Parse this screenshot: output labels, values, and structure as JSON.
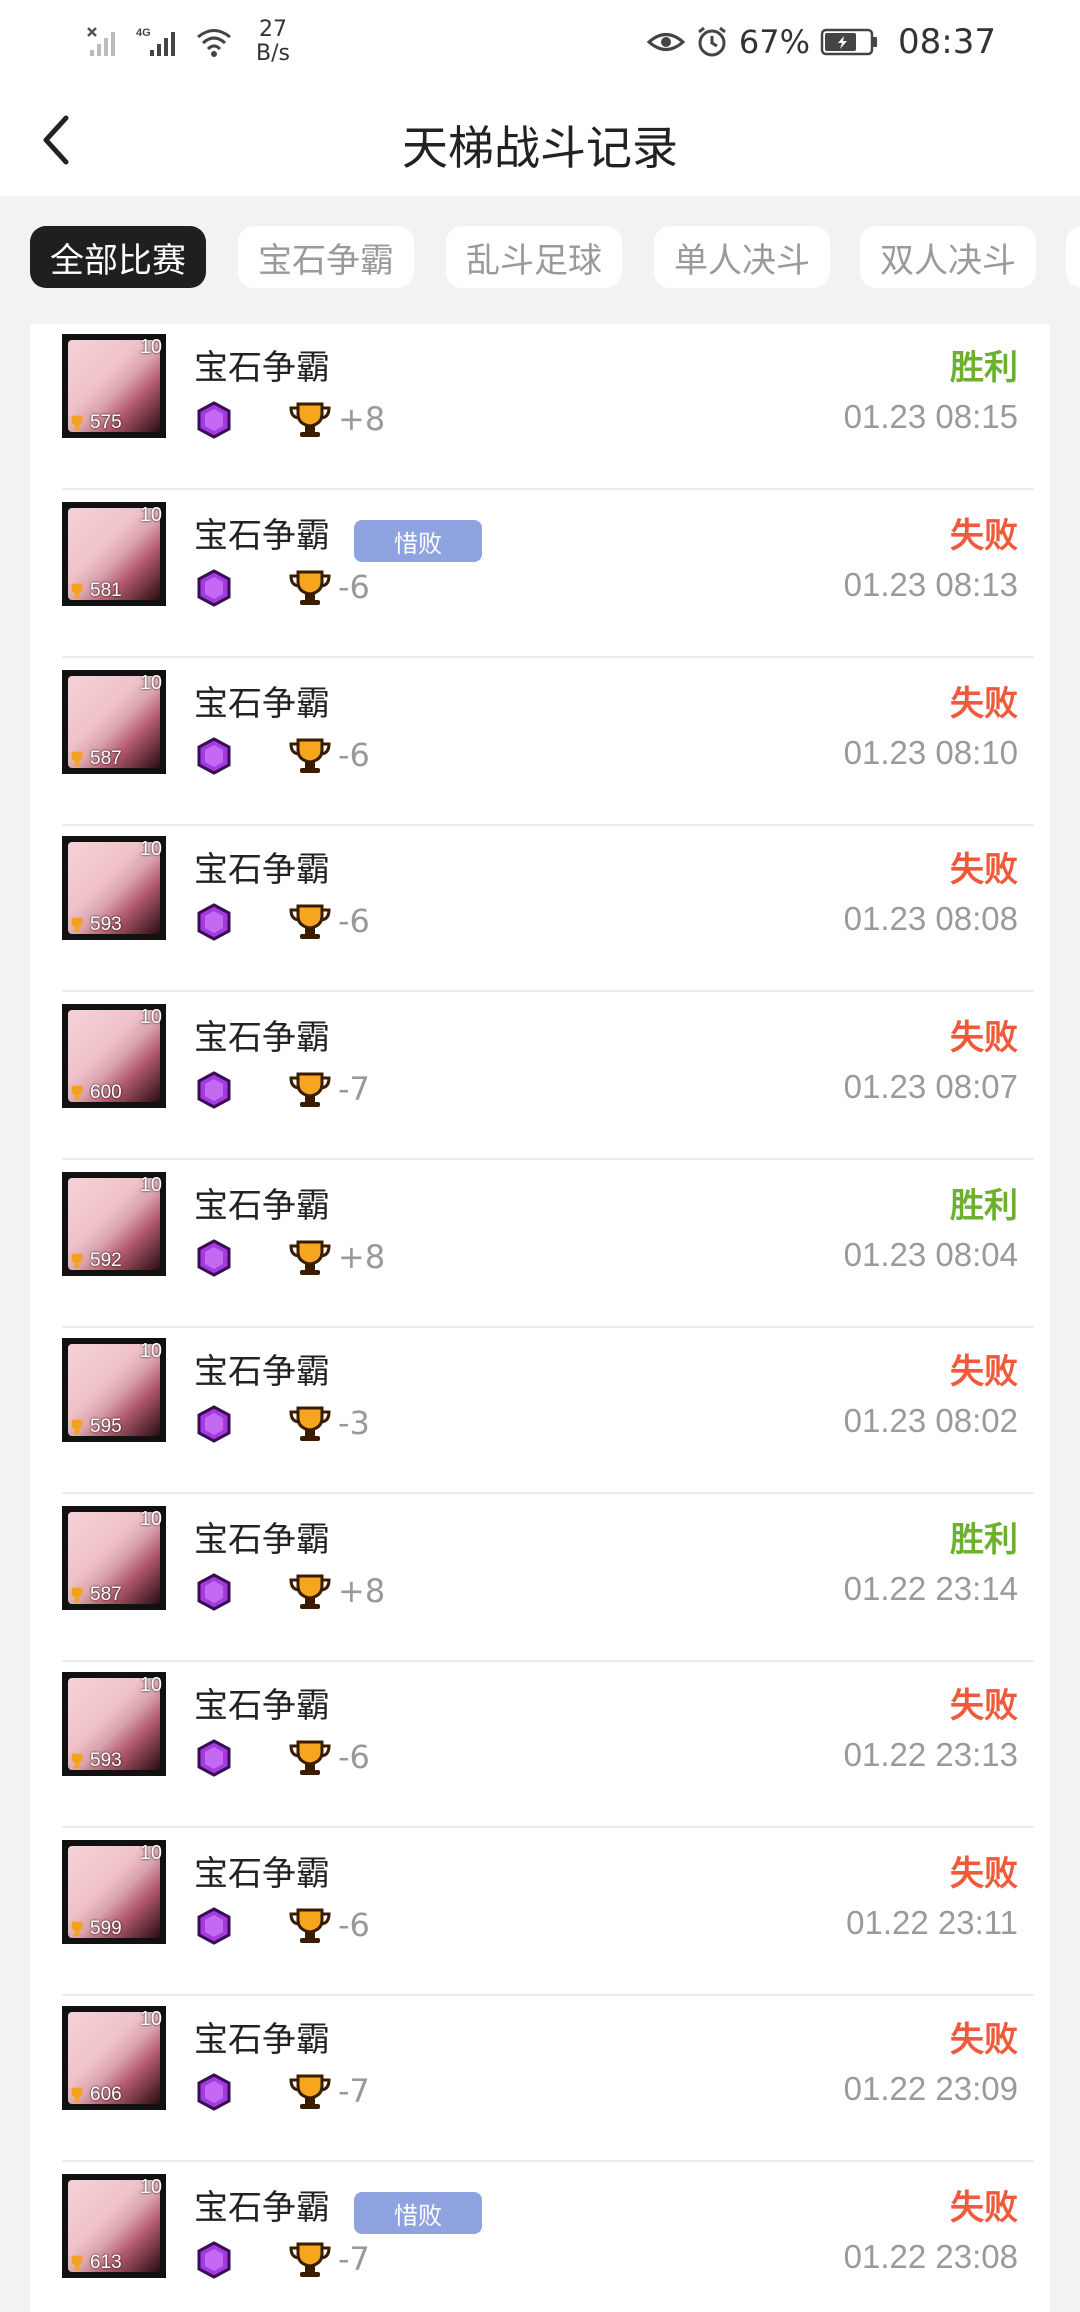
{
  "status_bar": {
    "net_speed_value": "27",
    "net_speed_unit": "B/s",
    "battery_percent": "67%",
    "time": "08:37",
    "icons": [
      "no-signal-icon",
      "4g-signal-icon",
      "wifi-icon",
      "eye-icon",
      "alarm-icon",
      "battery-icon"
    ]
  },
  "header": {
    "title": "天梯战斗记录",
    "back_icon": "chevron-left-icon"
  },
  "tabs": [
    {
      "label": "全部比赛",
      "active": true
    },
    {
      "label": "宝石争霸",
      "active": false
    },
    {
      "label": "乱斗足球",
      "active": false
    },
    {
      "label": "单人决斗",
      "active": false
    },
    {
      "label": "双人决斗",
      "active": false
    }
  ],
  "colors": {
    "win": "#6bb12d",
    "lose": "#f05a3a",
    "tag": "#8fa3e0",
    "active_tab": "#1f1f1f"
  },
  "battles": [
    {
      "avatar_level": "10",
      "avatar_trophies": "575",
      "mode": "宝石争霸",
      "tag": "",
      "trophy_delta": "+8",
      "result": "胜利",
      "outcome": "win",
      "time": "01.23 08:15"
    },
    {
      "avatar_level": "10",
      "avatar_trophies": "581",
      "mode": "宝石争霸",
      "tag": "惜败",
      "trophy_delta": "-6",
      "result": "失败",
      "outcome": "lose",
      "time": "01.23 08:13"
    },
    {
      "avatar_level": "10",
      "avatar_trophies": "587",
      "mode": "宝石争霸",
      "tag": "",
      "trophy_delta": "-6",
      "result": "失败",
      "outcome": "lose",
      "time": "01.23 08:10"
    },
    {
      "avatar_level": "10",
      "avatar_trophies": "593",
      "mode": "宝石争霸",
      "tag": "",
      "trophy_delta": "-6",
      "result": "失败",
      "outcome": "lose",
      "time": "01.23 08:08"
    },
    {
      "avatar_level": "10",
      "avatar_trophies": "600",
      "mode": "宝石争霸",
      "tag": "",
      "trophy_delta": "-7",
      "result": "失败",
      "outcome": "lose",
      "time": "01.23 08:07"
    },
    {
      "avatar_level": "10",
      "avatar_trophies": "592",
      "mode": "宝石争霸",
      "tag": "",
      "trophy_delta": "+8",
      "result": "胜利",
      "outcome": "win",
      "time": "01.23 08:04"
    },
    {
      "avatar_level": "10",
      "avatar_trophies": "595",
      "mode": "宝石争霸",
      "tag": "",
      "trophy_delta": "-3",
      "result": "失败",
      "outcome": "lose",
      "time": "01.23 08:02"
    },
    {
      "avatar_level": "10",
      "avatar_trophies": "587",
      "mode": "宝石争霸",
      "tag": "",
      "trophy_delta": "+8",
      "result": "胜利",
      "outcome": "win",
      "time": "01.22 23:14"
    },
    {
      "avatar_level": "10",
      "avatar_trophies": "593",
      "mode": "宝石争霸",
      "tag": "",
      "trophy_delta": "-6",
      "result": "失败",
      "outcome": "lose",
      "time": "01.22 23:13"
    },
    {
      "avatar_level": "10",
      "avatar_trophies": "599",
      "mode": "宝石争霸",
      "tag": "",
      "trophy_delta": "-6",
      "result": "失败",
      "outcome": "lose",
      "time": "01.22 23:11"
    },
    {
      "avatar_level": "10",
      "avatar_trophies": "606",
      "mode": "宝石争霸",
      "tag": "",
      "trophy_delta": "-7",
      "result": "失败",
      "outcome": "lose",
      "time": "01.22 23:09"
    },
    {
      "avatar_level": "10",
      "avatar_trophies": "613",
      "mode": "宝石争霸",
      "tag": "惜败",
      "trophy_delta": "-7",
      "result": "失败",
      "outcome": "lose",
      "time": "01.22 23:08"
    }
  ]
}
